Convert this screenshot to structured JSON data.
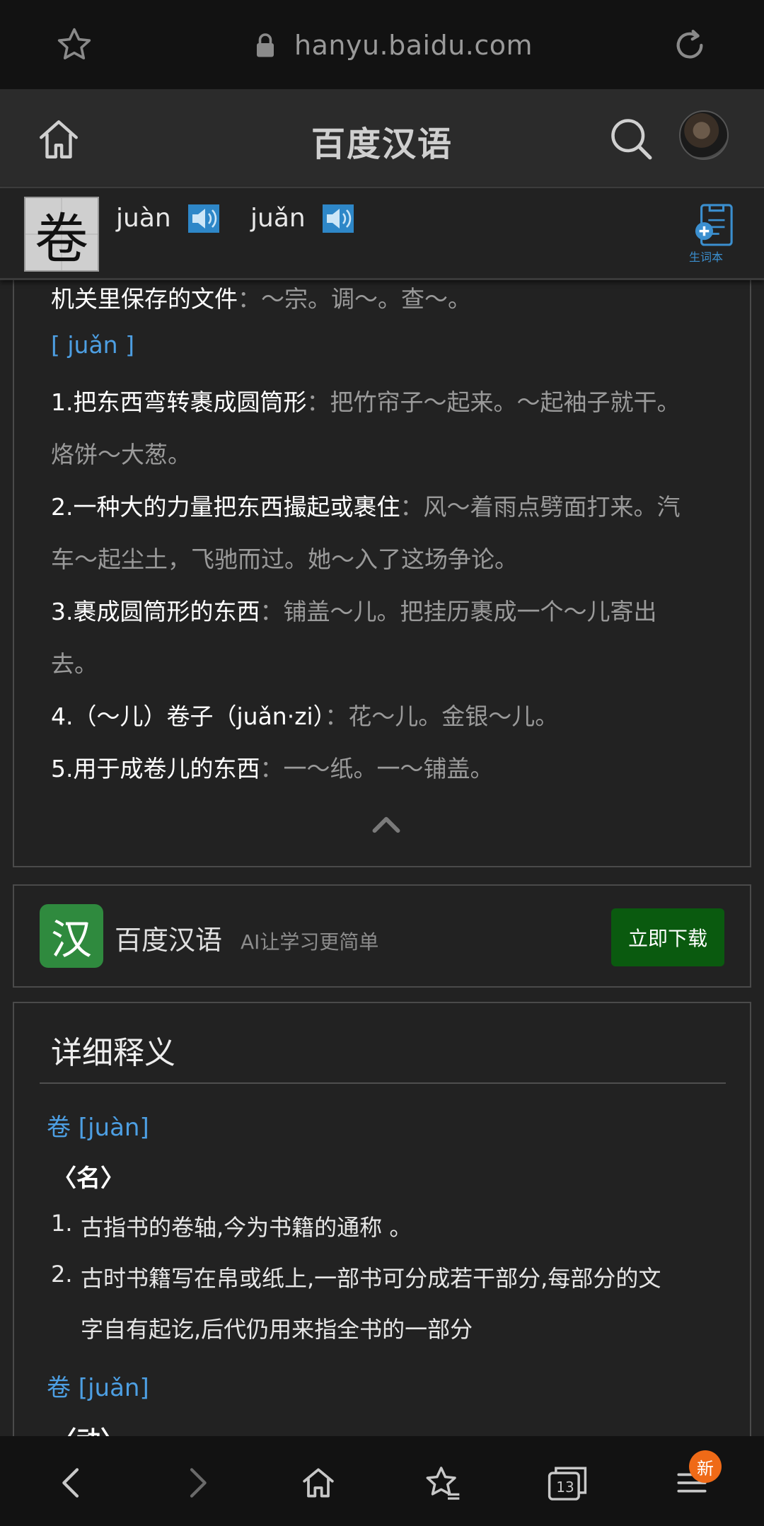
{
  "browser": {
    "url": "hanyu.baidu.com"
  },
  "header": {
    "title": "百度汉语"
  },
  "word": {
    "character": "卷",
    "pinyin": [
      "juàn",
      "juǎn"
    ],
    "vocab_label": "生词本"
  },
  "definitions": {
    "juan4_tail": {
      "text": "机关里保存的文件",
      "examples": "：～宗。调～。查～。"
    },
    "juan3_header": "[ juǎn ]",
    "juan3": [
      {
        "text": "1.把东西弯转裹成圆筒形",
        "ex_line1": "：把竹帘子～起来。～起袖子就干。",
        "ex_line2": "烙饼～大葱。"
      },
      {
        "text": "2.一种大的力量把东西撮起或裹住",
        "ex_line1": "：风～着雨点劈面打来。汽",
        "ex_line2": "车～起尘土，飞驰而过。她～入了这场争论。"
      },
      {
        "text": "3.裹成圆筒形的东西",
        "ex_line1": "：铺盖～儿。把挂历裹成一个～儿寄出",
        "ex_line2": "去。"
      },
      {
        "text": "4.（～儿）卷子（juǎn·zi）",
        "ex_line1": "：花～儿。金银～儿。",
        "ex_line2": ""
      },
      {
        "text": "5.用于成卷儿的东西",
        "ex_line1": "：一～纸。一～铺盖。",
        "ex_line2": ""
      }
    ]
  },
  "promo": {
    "logo_char": "汉",
    "name": "百度汉语",
    "slogan": "AI让学习更简单",
    "download": "立即下载"
  },
  "detail": {
    "title": "详细释义",
    "entries": [
      {
        "heading": "卷 [juàn]",
        "pos": "〈名〉",
        "items": [
          {
            "num": "1.",
            "line1": "古指书的卷轴,今为书籍的通称 。",
            "line2": ""
          },
          {
            "num": "2.",
            "line1": "古时书籍写在帛或纸上,一部书可分成若干部分,每部分的文",
            "line2": "字自有起讫,后代仍用来指全书的一部分"
          }
        ]
      },
      {
        "heading": "卷 [juǎn]",
        "pos": "〈动〉"
      }
    ]
  },
  "bottom_nav": {
    "tabs_count": "13",
    "badge": "新"
  },
  "colors": {
    "link_blue": "#4d9fe3",
    "download_green": "#0a5a0f",
    "badge_orange": "#ef6a17"
  }
}
